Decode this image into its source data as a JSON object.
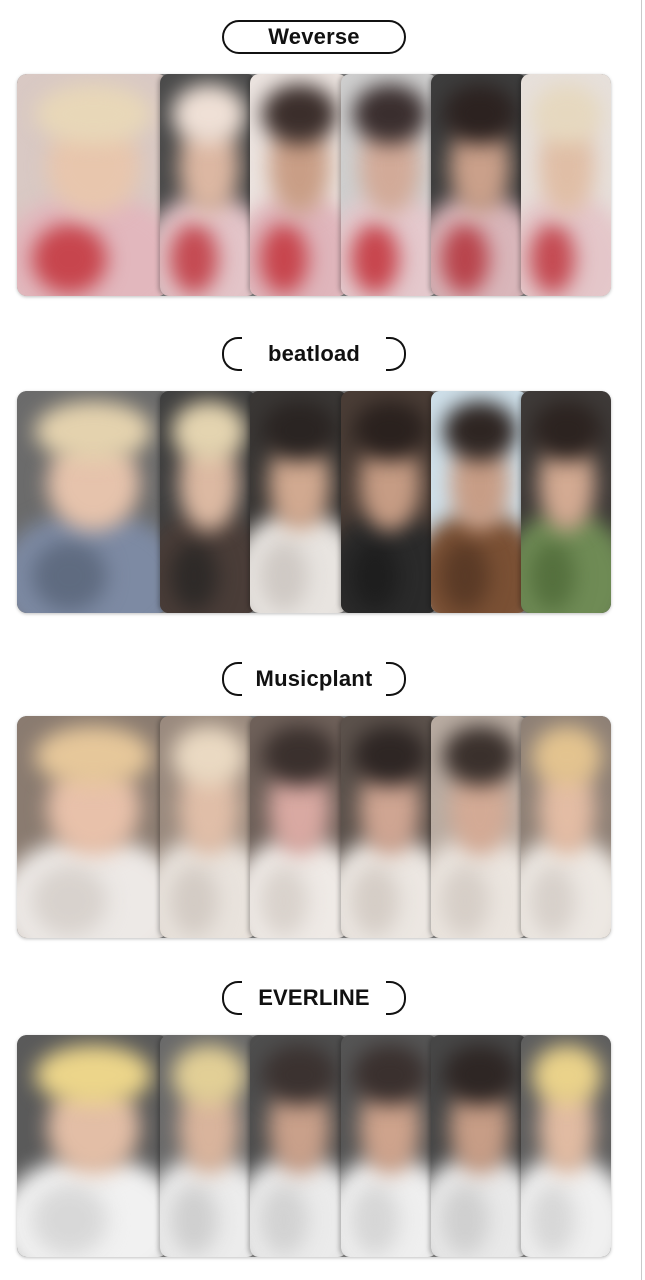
{
  "sections": [
    {
      "label": "Weverse",
      "style": "full",
      "cards": [
        {
          "bg": "#d9c9c4",
          "hair": "#e8d7b8",
          "face": "#e8c6ad",
          "shirt": "#e2b7bd",
          "accent": "#c7454d"
        },
        {
          "bg": "#4a4a4a",
          "hair": "#efe0d6",
          "face": "#dcb7a2",
          "shirt": "#e3c4c8",
          "accent": "#c44a52"
        },
        {
          "bg": "#ece4e0",
          "hair": "#3b2e2b",
          "face": "#c99e86",
          "shirt": "#dfb5bb",
          "accent": "#c7454d"
        },
        {
          "bg": "#cfcfcf",
          "hair": "#3a2e2e",
          "face": "#d2aa98",
          "shirt": "#e4c8cc",
          "accent": "#c7454d"
        },
        {
          "bg": "#3d3d3d",
          "hair": "#2c2220",
          "face": "#caa08a",
          "shirt": "#d9b6ba",
          "accent": "#b8444c"
        },
        {
          "bg": "#e7e0db",
          "hair": "#e6d8bf",
          "face": "#e0bea6",
          "shirt": "#e4c6c9",
          "accent": "#c44a52"
        }
      ]
    },
    {
      "label": "beatload",
      "style": "bracket",
      "cards": [
        {
          "bg": "#6b6b6b",
          "hair": "#e4d2ae",
          "face": "#e6c3ac",
          "shirt": "#7d8aa3",
          "accent": "#5f6b80"
        },
        {
          "bg": "#3f3f3f",
          "hair": "#e4d4b0",
          "face": "#dcb9a2",
          "shirt": "#4a3d38",
          "accent": "#2e2a28"
        },
        {
          "bg": "#3a3735",
          "hair": "#2a2422",
          "face": "#d1a990",
          "shirt": "#e8e4e0",
          "accent": "#cfc9c4"
        },
        {
          "bg": "#4a3d36",
          "hair": "#2a211e",
          "face": "#c69c84",
          "shirt": "#2a2a2a",
          "accent": "#1e1e1e"
        },
        {
          "bg": "#cfe0ea",
          "hair": "#2e2522",
          "face": "#c79d86",
          "shirt": "#7a5034",
          "accent": "#5a3a26"
        },
        {
          "bg": "#3e3a38",
          "hair": "#2c2320",
          "face": "#d3aa92",
          "shirt": "#6f8b55",
          "accent": "#55703e"
        }
      ]
    },
    {
      "label": "Musicplant",
      "style": "bracket",
      "cards": [
        {
          "bg": "#8a7b70",
          "hair": "#e6c79a",
          "face": "#e8c1aa",
          "shirt": "#ede9e6",
          "accent": "#d8d2cd"
        },
        {
          "bg": "#9a8a7e",
          "hair": "#ead9c2",
          "face": "#e0bea8",
          "shirt": "#e9e3dd",
          "accent": "#d3cbc4"
        },
        {
          "bg": "#6f615a",
          "hair": "#3a302d",
          "face": "#d9a9a2",
          "shirt": "#efeae6",
          "accent": "#d9d2cc"
        },
        {
          "bg": "#5c524c",
          "hair": "#2e2624",
          "face": "#cfa592",
          "shirt": "#ece7e2",
          "accent": "#d5cdc6"
        },
        {
          "bg": "#b9aca2",
          "hair": "#3a302c",
          "face": "#d3aa95",
          "shirt": "#ebe5df",
          "accent": "#d6cec7"
        },
        {
          "bg": "#8e8076",
          "hair": "#e3c38f",
          "face": "#e3bca4",
          "shirt": "#ede8e3",
          "accent": "#d7d0ca"
        }
      ]
    },
    {
      "label": "EVERLINE",
      "style": "bracket",
      "cards": [
        {
          "bg": "#5a5a5a",
          "hair": "#ecd58a",
          "face": "#e3bea6",
          "shirt": "#f1f1f1",
          "accent": "#d8d8d8"
        },
        {
          "bg": "#6a6a6a",
          "hair": "#e2cf96",
          "face": "#d9b49c",
          "shirt": "#ececec",
          "accent": "#cfcfcf"
        },
        {
          "bg": "#4e4e4e",
          "hair": "#3b3230",
          "face": "#c9a08a",
          "shirt": "#ebebeb",
          "accent": "#d2d2d2"
        },
        {
          "bg": "#555555",
          "hair": "#3a302e",
          "face": "#ceA38c",
          "shirt": "#efefef",
          "accent": "#d6d6d6"
        },
        {
          "bg": "#474747",
          "hair": "#2e2624",
          "face": "#c79d86",
          "shirt": "#e9e9e9",
          "accent": "#cfcfcf"
        },
        {
          "bg": "#5e5e5e",
          "hair": "#ead28a",
          "face": "#e1bba2",
          "shirt": "#f0f0f0",
          "accent": "#d7d7d7"
        }
      ]
    }
  ]
}
